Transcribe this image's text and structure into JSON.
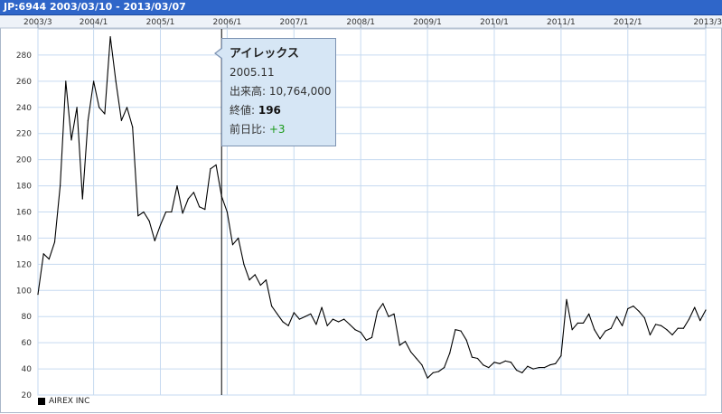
{
  "header": {
    "title": "JP:6944 2003/03/10 - 2013/03/07"
  },
  "tooltip": {
    "name": "アイレックス",
    "date": "2005.11",
    "volume": "出来高: 10,764,000",
    "close_label": "終値: ",
    "close_value": "196",
    "change_label": "前日比: ",
    "change_value": "+3"
  },
  "chart_data": {
    "type": "line",
    "title": "",
    "xlabel": "",
    "ylabel": "",
    "x_ticks": [
      "2003/3",
      "2004/1",
      "2005/1",
      "2006/1",
      "2007/1",
      "2008/1",
      "2009/1",
      "2010/1",
      "2011/1",
      "2012/1",
      "2013/3"
    ],
    "y_ticks": [
      20,
      40,
      60,
      80,
      100,
      120,
      140,
      160,
      180,
      200,
      220,
      240,
      260,
      280
    ],
    "ylim": [
      20,
      300
    ],
    "xlim": [
      "2003-03",
      "2013-03"
    ],
    "grid": true,
    "legend": "bottom-left",
    "crosshair_x": "2005-12",
    "series": [
      {
        "name": "AIREX INC",
        "color": "#000000",
        "points": [
          [
            "2003-03",
            97
          ],
          [
            "2003-04",
            128
          ],
          [
            "2003-05",
            124
          ],
          [
            "2003-06",
            137
          ],
          [
            "2003-07",
            180
          ],
          [
            "2003-08",
            260
          ],
          [
            "2003-09",
            215
          ],
          [
            "2003-10",
            240
          ],
          [
            "2003-11",
            170
          ],
          [
            "2003-12",
            230
          ],
          [
            "2004-01",
            260
          ],
          [
            "2004-02",
            240
          ],
          [
            "2004-03",
            235
          ],
          [
            "2004-04",
            294
          ],
          [
            "2004-05",
            260
          ],
          [
            "2004-06",
            230
          ],
          [
            "2004-07",
            240
          ],
          [
            "2004-08",
            225
          ],
          [
            "2004-09",
            157
          ],
          [
            "2004-10",
            160
          ],
          [
            "2004-11",
            153
          ],
          [
            "2004-12",
            138
          ],
          [
            "2005-01",
            150
          ],
          [
            "2005-02",
            160
          ],
          [
            "2005-03",
            160
          ],
          [
            "2005-04",
            180
          ],
          [
            "2005-05",
            159
          ],
          [
            "2005-06",
            170
          ],
          [
            "2005-07",
            175
          ],
          [
            "2005-08",
            164
          ],
          [
            "2005-09",
            162
          ],
          [
            "2005-10",
            193
          ],
          [
            "2005-11",
            196
          ],
          [
            "2005-12",
            172
          ],
          [
            "2006-01",
            160
          ],
          [
            "2006-02",
            135
          ],
          [
            "2006-03",
            140
          ],
          [
            "2006-04",
            120
          ],
          [
            "2006-05",
            108
          ],
          [
            "2006-06",
            112
          ],
          [
            "2006-07",
            104
          ],
          [
            "2006-08",
            108
          ],
          [
            "2006-09",
            88
          ],
          [
            "2006-10",
            82
          ],
          [
            "2006-11",
            76
          ],
          [
            "2006-12",
            73
          ],
          [
            "2007-01",
            83
          ],
          [
            "2007-02",
            78
          ],
          [
            "2007-03",
            80
          ],
          [
            "2007-04",
            82
          ],
          [
            "2007-05",
            74
          ],
          [
            "2007-06",
            87
          ],
          [
            "2007-07",
            73
          ],
          [
            "2007-08",
            78
          ],
          [
            "2007-09",
            76
          ],
          [
            "2007-10",
            78
          ],
          [
            "2007-11",
            74
          ],
          [
            "2007-12",
            70
          ],
          [
            "2008-01",
            68
          ],
          [
            "2008-02",
            62
          ],
          [
            "2008-03",
            64
          ],
          [
            "2008-04",
            84
          ],
          [
            "2008-05",
            90
          ],
          [
            "2008-06",
            80
          ],
          [
            "2008-07",
            82
          ],
          [
            "2008-08",
            58
          ],
          [
            "2008-09",
            61
          ],
          [
            "2008-10",
            53
          ],
          [
            "2008-11",
            48
          ],
          [
            "2008-12",
            43
          ],
          [
            "2009-01",
            33
          ],
          [
            "2009-02",
            37
          ],
          [
            "2009-03",
            38
          ],
          [
            "2009-04",
            41
          ],
          [
            "2009-05",
            52
          ],
          [
            "2009-06",
            70
          ],
          [
            "2009-07",
            69
          ],
          [
            "2009-08",
            62
          ],
          [
            "2009-09",
            49
          ],
          [
            "2009-10",
            48
          ],
          [
            "2009-11",
            43
          ],
          [
            "2009-12",
            41
          ],
          [
            "2010-01",
            45
          ],
          [
            "2010-02",
            44
          ],
          [
            "2010-03",
            46
          ],
          [
            "2010-04",
            45
          ],
          [
            "2010-05",
            39
          ],
          [
            "2010-06",
            37
          ],
          [
            "2010-07",
            42
          ],
          [
            "2010-08",
            40
          ],
          [
            "2010-09",
            41
          ],
          [
            "2010-10",
            41
          ],
          [
            "2010-11",
            43
          ],
          [
            "2010-12",
            44
          ],
          [
            "2011-01",
            50
          ],
          [
            "2011-02",
            93
          ],
          [
            "2011-03",
            70
          ],
          [
            "2011-04",
            75
          ],
          [
            "2011-05",
            75
          ],
          [
            "2011-06",
            82
          ],
          [
            "2011-07",
            70
          ],
          [
            "2011-08",
            63
          ],
          [
            "2011-09",
            69
          ],
          [
            "2011-10",
            71
          ],
          [
            "2011-11",
            80
          ],
          [
            "2011-12",
            73
          ],
          [
            "2012-01",
            86
          ],
          [
            "2012-02",
            88
          ],
          [
            "2012-03",
            84
          ],
          [
            "2012-04",
            79
          ],
          [
            "2012-05",
            66
          ],
          [
            "2012-06",
            74
          ],
          [
            "2012-07",
            73
          ],
          [
            "2012-08",
            70
          ],
          [
            "2012-09",
            66
          ],
          [
            "2012-10",
            71
          ],
          [
            "2012-11",
            71
          ],
          [
            "2012-12",
            78
          ],
          [
            "2013-01",
            87
          ],
          [
            "2013-02",
            77
          ],
          [
            "2013-03",
            85
          ]
        ]
      }
    ]
  }
}
